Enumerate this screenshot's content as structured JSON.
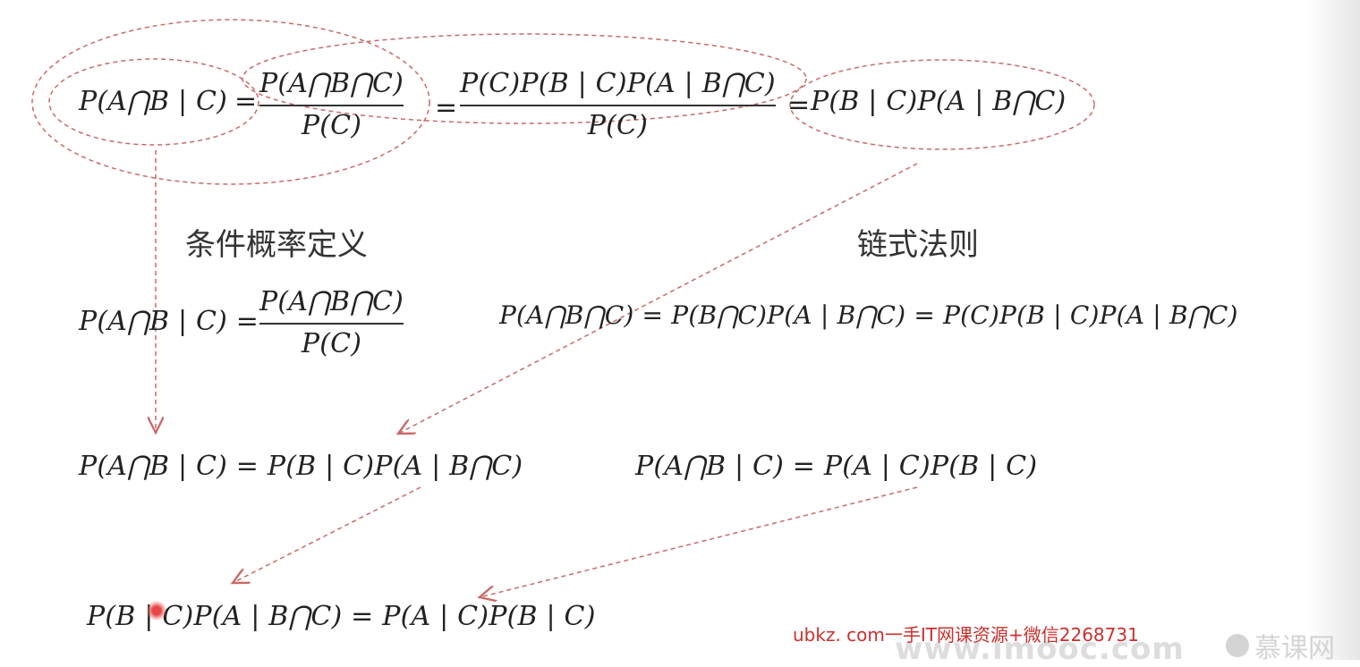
{
  "top_row": {
    "lhs": "P(A⋂B | C)",
    "eq1": "=",
    "frac1": {
      "numerator": "P(A⋂B⋂C)",
      "denominator": "P(C)"
    },
    "eq2": "=",
    "frac2": {
      "numerator": "P(C)P(B | C)P(A | B⋂C)",
      "denominator": "P(C)"
    },
    "eq3": "=",
    "result": "P(B | C)P(A | B⋂C)"
  },
  "labels": {
    "conditional_definition": "条件概率定义",
    "chain_rule": "链式法则"
  },
  "middle_row": {
    "def_lhs": "P(A⋂B | C) =",
    "def_frac": {
      "numerator": "P(A⋂B⋂C)",
      "denominator": "P(C)"
    },
    "chain_formula": "P(A⋂B⋂C) = P(B⋂C)P(A | B⋂C) = P(C)P(B | C)P(A | B⋂C)"
  },
  "lower_row": {
    "left_formula": "P(A⋂B | C) = P(B | C)P(A | B⋂C)",
    "right_formula": "P(A⋂B | C) = P(A | C)P(B | C)"
  },
  "bottom_row": {
    "formula": "P(B | C)P(A | B⋂C) = P(A | C)P(B | C)"
  },
  "watermark": {
    "text": "ubkz. com一手IT网课资源+微信2268731",
    "site": "www.imooc.com",
    "logo": "慕课网"
  },
  "colors": {
    "connector": "#c0504d",
    "watermark_red": "#c9302c"
  }
}
